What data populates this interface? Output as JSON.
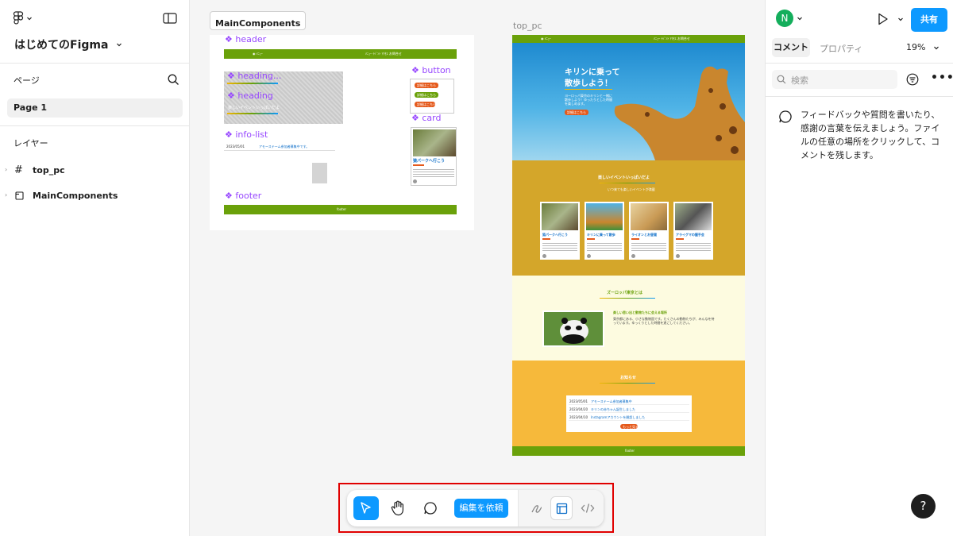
{
  "left": {
    "file_name": "はじめてのFigma",
    "pages_label": "ページ",
    "page_item": "Page 1",
    "layers_label": "レイヤー",
    "layers": [
      {
        "label": "top_pc"
      },
      {
        "label": "MainComponents"
      }
    ]
  },
  "canvas": {
    "main_frame_label": "MainComponents",
    "top_frame_label": "top_pc",
    "components": {
      "header": "header",
      "heading1": "heading...",
      "heading2": "heading",
      "heading_sub": "楽しいイベントいっぱいだよ",
      "info_list": "info-list",
      "footer": "footer",
      "button": "button",
      "card": "card",
      "btn_texts": [
        "詳細はこちら",
        "詳細はこちら",
        "詳細はこちら"
      ],
      "card_title": "猿パークへ行こう",
      "info_date": "2023/05/01",
      "info_text": "アモーステーム参加者募集中です。",
      "footer_text": "footer"
    },
    "top_pc": {
      "hero_title_1": "キリンに乗って",
      "hero_title_2": "散歩しよう！",
      "hero_desc": "ヨーロッパ東京のキリンと一緒に散歩しよう！ゆったりとした時間を楽しめます。",
      "hero_btn": "詳細はこちら",
      "events_title": "楽しいイベントいっぱいだよ",
      "events_sub": "いつ来ても楽しいイベントが満載",
      "cards": [
        {
          "title": "猿パークへ行こう"
        },
        {
          "title": "キリンに乗って散歩"
        },
        {
          "title": "ライオンとお昼寝"
        },
        {
          "title": "アライグマの握手会"
        }
      ],
      "about_title": "ズーロッパ東京とは",
      "about_sub": "楽しい思い出と動物たちに会える場所",
      "about_desc": "東京都にある、小さな動物園です。たくさんの動物たちが、みんなを待っています。ゆっくりとした時間を過ごしてください。",
      "news_title": "お知らせ",
      "news": [
        {
          "date": "2023/05/01",
          "text": "アモーステーム参加者募集中"
        },
        {
          "date": "2023/04/20",
          "text": "キリンの赤ちゃん誕生しました"
        },
        {
          "date": "2023/04/10",
          "text": "Instagramアカウントを開設しました"
        }
      ],
      "news_btn": "もっと見る",
      "footer_text": "footer"
    }
  },
  "toolbar": {
    "request_edit": "編集を依頼"
  },
  "right": {
    "avatar_letter": "N",
    "share": "共有",
    "tab_comments": "コメント",
    "tab_properties": "プロパティ",
    "zoom": "19%",
    "search_placeholder": "検索",
    "empty_message": "フィードバックや質問を書いたり、感謝の言葉を伝えましょう。ファイルの任意の場所をクリックして、コメントを残します。",
    "help": "?"
  },
  "colors": {
    "accent": "#0d99ff",
    "highlight": "#e00000",
    "component": "#9747ff",
    "green": "#6aa10a",
    "orange": "#e55a1c"
  }
}
